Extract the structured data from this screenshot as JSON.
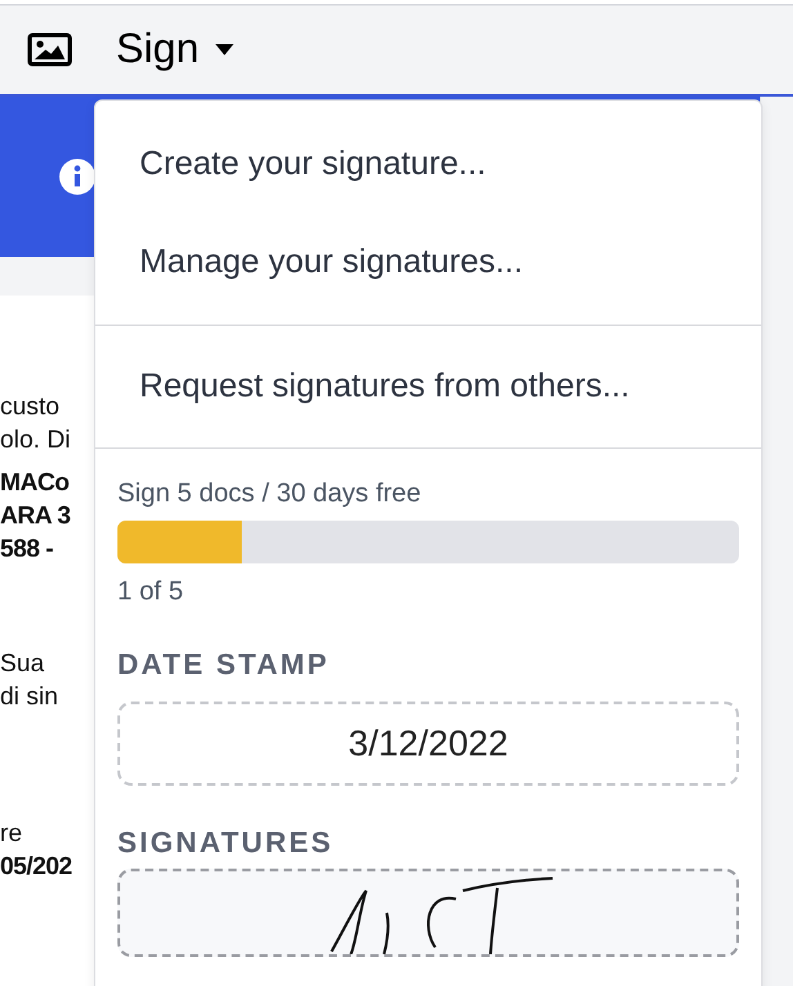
{
  "toolbar": {
    "menu_button": {
      "label": "Sign",
      "expanded": true
    }
  },
  "document": {
    "paragraphs": [
      {
        "lines": [
          {
            "text": "custo",
            "bold": false
          },
          {
            "text": "olo. Di",
            "bold": false
          }
        ]
      },
      {
        "lines": [
          {
            "text": "MACo",
            "bold": true
          },
          {
            "text": "ARA 3",
            "bold": true
          },
          {
            "text": "588 -",
            "bold": true
          }
        ]
      },
      {
        "lines": [
          {
            "text": "Sua",
            "bold": false
          },
          {
            "text": "di sin",
            "bold": false
          }
        ]
      },
      {
        "lines": [
          {
            "text": "re",
            "bold": false
          },
          {
            "text": "05/202",
            "bold": true
          }
        ]
      }
    ]
  },
  "menu": {
    "groups": [
      {
        "items": [
          "Create your signature...",
          "Manage your signatures..."
        ]
      },
      {
        "items": [
          "Request signatures from others..."
        ]
      }
    ],
    "trial": {
      "text": "Sign 5 docs / 30 days free",
      "level": 0.2,
      "count": "1 of 5"
    },
    "date_stamp": {
      "heading": "DATE STAMP",
      "value": "3/12/2022"
    },
    "signatures": {
      "heading": "SIGNATURES"
    }
  }
}
